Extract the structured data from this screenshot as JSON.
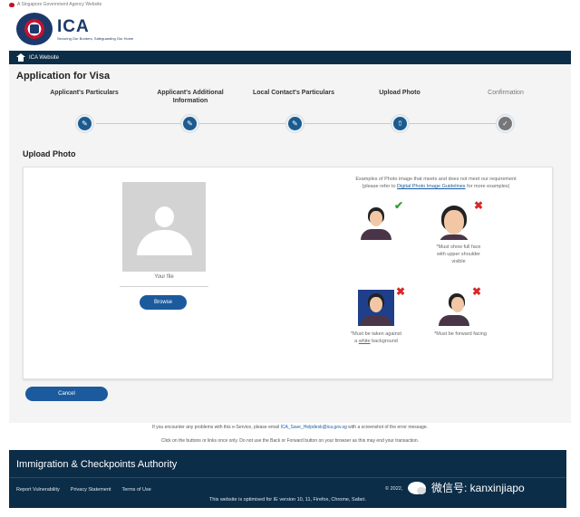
{
  "gov_bar": {
    "text": "A Singapore Government Agency Website"
  },
  "header": {
    "logo_text": "ICA",
    "logo_tagline": "Securing Our Borders, Safeguarding Our Home"
  },
  "nav": {
    "link": "ICA Website"
  },
  "page": {
    "title": "Application for Visa"
  },
  "steps": [
    {
      "label": "Applicant's Particulars",
      "icon": "pencil-icon",
      "state": "done"
    },
    {
      "label": "Applicant's Additional Information",
      "icon": "pencil-icon",
      "state": "done"
    },
    {
      "label": "Local Contact's Particulars",
      "icon": "pencil-icon",
      "state": "done"
    },
    {
      "label": "Upload Photo",
      "icon": "upload-icon",
      "state": "current"
    },
    {
      "label": "Confirmation",
      "icon": "check-icon",
      "state": "pending"
    }
  ],
  "upload": {
    "section_title": "Upload Photo",
    "file_label": "Your file",
    "browse_label": "Browse"
  },
  "examples": {
    "caption_line1": "Examples of Photo image that meets and does not meet our requirement",
    "caption_prefix": "(please refer to ",
    "caption_link": "Digital Photo Image Guidelines",
    "caption_suffix": " for more examples)",
    "notes": [
      "",
      "*Must show full face with upper shoulder visible",
      "*Must be taken against a white background",
      "*Must be forward facing"
    ],
    "note_white_word": "white",
    "note_bg_prefix": "*Must be taken against a ",
    "note_bg_suffix": " background"
  },
  "actions": {
    "cancel_label": "Cancel"
  },
  "help": {
    "line1_prefix": "If you encounter any problems with this e-Service, please email ",
    "line1_email": "ICA_Save_Helpdesk@ica.gov.sg",
    "line1_suffix": " with a screenshot of the error message.",
    "line2": "Click on the buttons or links once only. Do not use the Back or Forward button on your browser as this may end your transaction."
  },
  "footer": {
    "title": "Immigration & Checkpoints Authority",
    "links": [
      "Report Vulnerability",
      "Privacy Statement",
      "Terms of Use"
    ],
    "copyright": "© 2022,",
    "note": "This website is optimised for IE version 10, 11, Firefox, Chrome, Safari."
  },
  "watermark": {
    "text": "微信号: kanxinjiapo"
  },
  "colors": {
    "navy": "#0c2d48",
    "button_blue": "#1c5a9e",
    "ok_green": "#3a9d3a",
    "bad_red": "#d42a2a"
  }
}
